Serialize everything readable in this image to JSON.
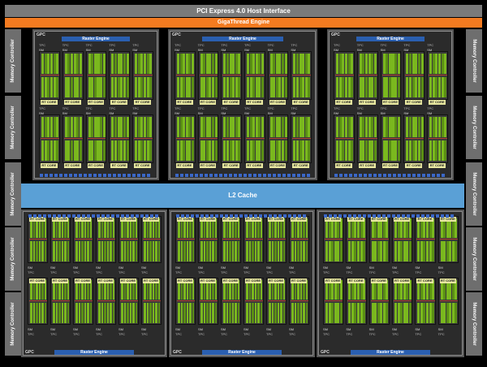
{
  "pcie": "PCI Express 4.0 Host Interface",
  "gigathread": "GigaThread Engine",
  "l2": "L2 Cache",
  "memory_controller": "Memory Controller",
  "gpc_label": "GPC",
  "raster_engine": "Raster Engine",
  "tpc_label": "TPC",
  "polymorph": "PolyMorph Engine",
  "sm_label": "SM",
  "rt_core": "RT CORE",
  "colors": {
    "pcie": "#7a7a7a",
    "gigathread": "#f47b20",
    "l2": "#5aa0d6",
    "raster": "#2a5fb0",
    "core_green": "#7ab81e",
    "rt": "#e8e8a0"
  }
}
